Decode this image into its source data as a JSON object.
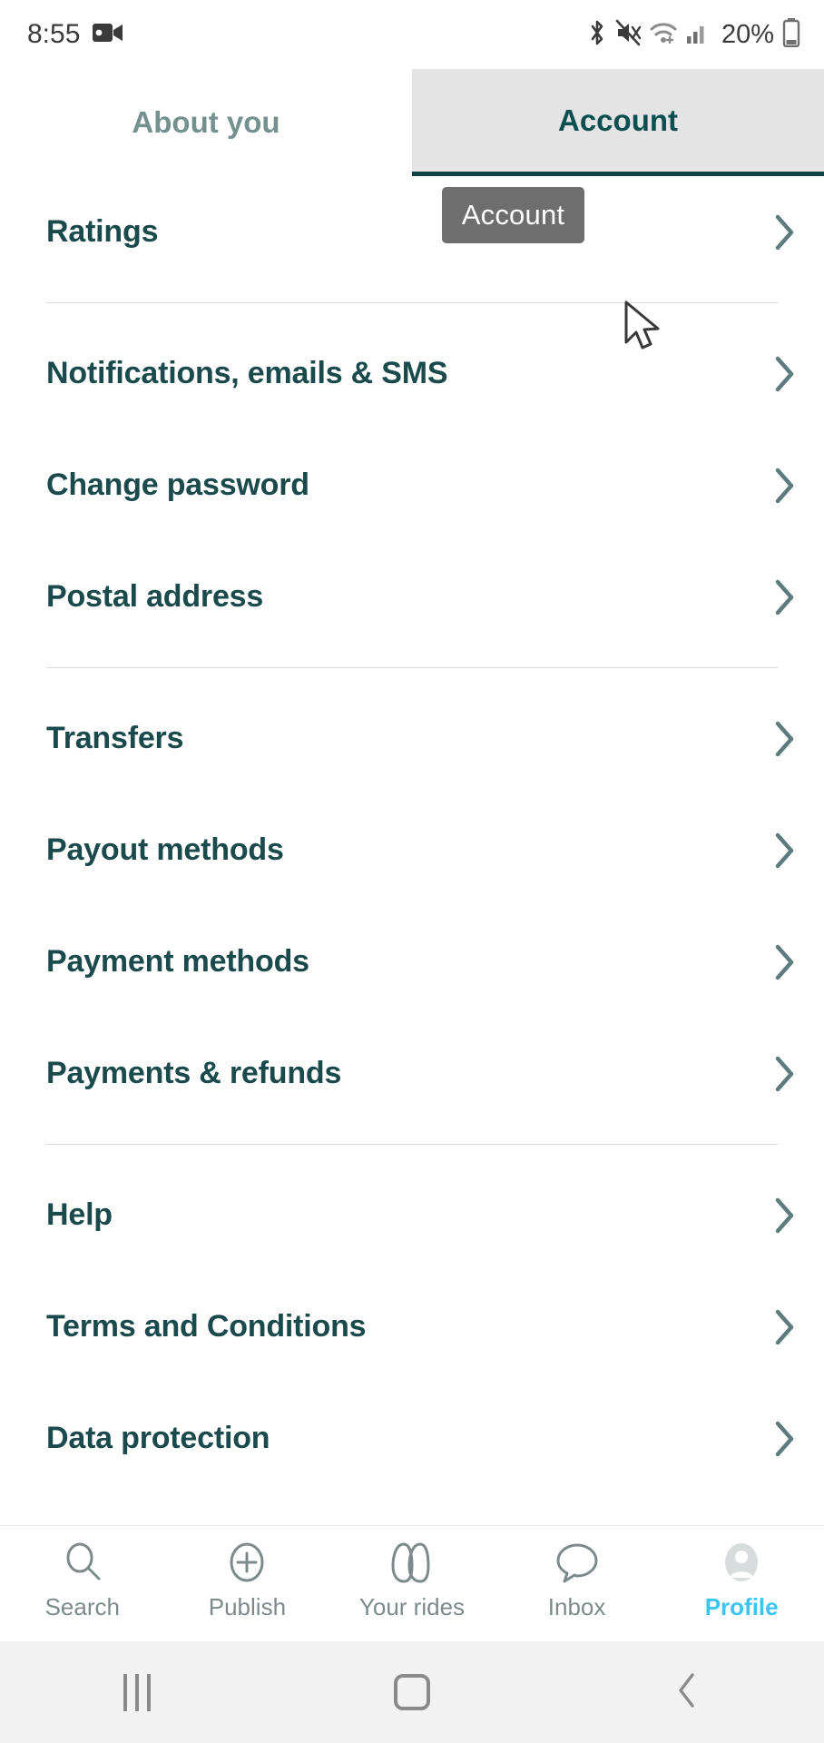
{
  "status_bar": {
    "time": "8:55",
    "battery_percent": "20%",
    "icons": [
      "video-camera-icon",
      "bluetooth-icon",
      "mute-icon",
      "wifi-icon",
      "cellular-signal-icon",
      "battery-icon"
    ]
  },
  "tabs": [
    {
      "label": "About you",
      "active": false
    },
    {
      "label": "Account",
      "active": true
    }
  ],
  "tooltip": {
    "label": "Account"
  },
  "menu": {
    "groups": [
      {
        "items": [
          {
            "label": "Ratings"
          }
        ]
      },
      {
        "items": [
          {
            "label": "Notifications, emails & SMS"
          },
          {
            "label": "Change password"
          },
          {
            "label": "Postal address"
          }
        ]
      },
      {
        "items": [
          {
            "label": "Transfers"
          },
          {
            "label": "Payout methods"
          },
          {
            "label": "Payment methods"
          },
          {
            "label": "Payments & refunds"
          }
        ]
      },
      {
        "items": [
          {
            "label": "Help"
          },
          {
            "label": "Terms and Conditions"
          },
          {
            "label": "Data protection"
          }
        ]
      }
    ]
  },
  "bottom_nav": {
    "items": [
      {
        "label": "Search",
        "icon": "search-icon",
        "active": false
      },
      {
        "label": "Publish",
        "icon": "plus-circle-icon",
        "active": false
      },
      {
        "label": "Your rides",
        "icon": "rides-icon",
        "active": false
      },
      {
        "label": "Inbox",
        "icon": "chat-bubble-icon",
        "active": false
      },
      {
        "label": "Profile",
        "icon": "avatar-icon",
        "active": true
      }
    ]
  },
  "android_nav": {
    "recents": "recents-icon",
    "home": "home-icon",
    "back": "back-icon"
  },
  "colors": {
    "accent_teal": "#1b4a4c",
    "active_tab_bg": "#e4e4e4",
    "active_tab_underline": "#0d4345",
    "profile_active": "#3ec5ef",
    "tooltip_bg": "#6e6e6e",
    "divider": "#d6dcdc"
  }
}
